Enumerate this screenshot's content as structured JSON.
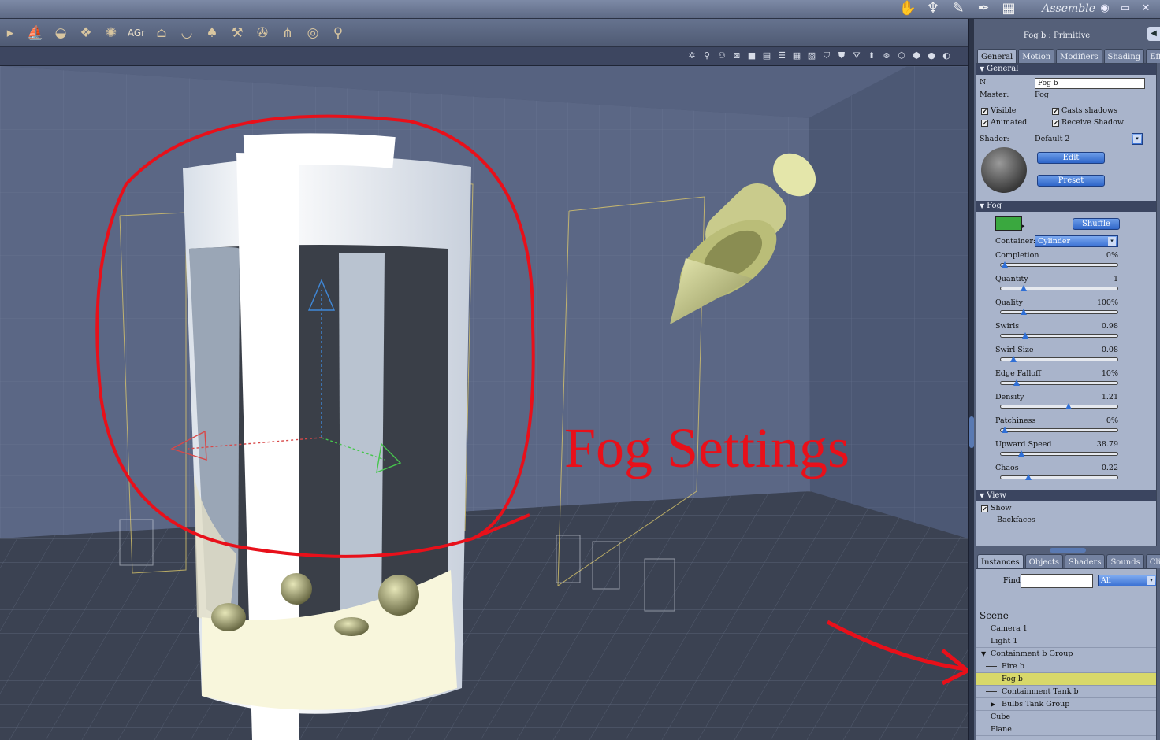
{
  "titlebar": {
    "mode": "Assemble",
    "room_icons": [
      "hand-icon",
      "brush-icon",
      "pencil-icon",
      "feather-icon",
      "ruler-icon"
    ],
    "window_buttons": [
      "eye-icon",
      "restore-icon",
      "close-icon"
    ]
  },
  "toolbar": {
    "tools": [
      "hand-tool",
      "boat",
      "bowl",
      "crate",
      "fan",
      "AGr",
      "house",
      "basket",
      "bell",
      "hammer",
      "camera-rig",
      "network",
      "target",
      "bone"
    ],
    "agr_label": "AGr"
  },
  "viewport": {
    "annotation": "Fog Settings"
  },
  "panel": {
    "title": "Fog b : Primitive",
    "tabs": [
      "General",
      "Motion",
      "Modifiers",
      "Shading",
      "Effects"
    ],
    "active_tab": "General",
    "general": {
      "header": "General",
      "name_label": "N",
      "name_value": "Fog b",
      "master_label": "Master:",
      "master_value": "Fog",
      "visible": "Visible",
      "casts_shadows": "Casts shadows",
      "animated": "Animated",
      "receive_shadow": "Receive Shadow",
      "shader_label": "Shader:",
      "shader_value": "Default 2",
      "edit": "Edit",
      "preset": "Preset"
    },
    "fog": {
      "header": "Fog",
      "color": "#3aa83f",
      "shuffle": "Shuffle",
      "container_label": "Container:",
      "container_value": "Cylinder",
      "sliders": [
        {
          "label": "Completion",
          "value": "0%",
          "pos": 0.04
        },
        {
          "label": "Quantity",
          "value": "1",
          "pos": 0.2
        },
        {
          "label": "Quality",
          "value": "100%",
          "pos": 0.2
        },
        {
          "label": "Swirls",
          "value": "0.98",
          "pos": 0.21
        },
        {
          "label": "Swirl Size",
          "value": "0.08",
          "pos": 0.11
        },
        {
          "label": "Edge Falloff",
          "value": "10%",
          "pos": 0.14
        },
        {
          "label": "Density",
          "value": "1.21",
          "pos": 0.58
        },
        {
          "label": "Patchiness",
          "value": "0%",
          "pos": 0.04
        },
        {
          "label": "Upward Speed",
          "value": "38.79",
          "pos": 0.18
        },
        {
          "label": "Chaos",
          "value": "0.22",
          "pos": 0.24
        }
      ]
    },
    "view": {
      "header": "View",
      "show": "Show",
      "backfaces": "Backfaces"
    }
  },
  "lower": {
    "tabs": [
      "Instances",
      "Objects",
      "Shaders",
      "Sounds",
      "Clips"
    ],
    "active_tab": "Instances",
    "find_label": "Find:",
    "find_value": "",
    "filter_value": "All",
    "scene_label": "Scene",
    "tree": [
      {
        "label": "Camera 1",
        "indent": 0
      },
      {
        "label": "Light 1",
        "indent": 0
      },
      {
        "label": "Containment b Group",
        "indent": 0,
        "expanded": true
      },
      {
        "label": "Fire b",
        "indent": 1
      },
      {
        "label": "Fog b",
        "indent": 1,
        "selected": true
      },
      {
        "label": "Containment Tank b",
        "indent": 1
      },
      {
        "label": "Bulbs Tank Group",
        "indent": 1,
        "collapsed": true
      },
      {
        "label": "Cube",
        "indent": 0
      },
      {
        "label": "Plane",
        "indent": 0
      }
    ]
  }
}
